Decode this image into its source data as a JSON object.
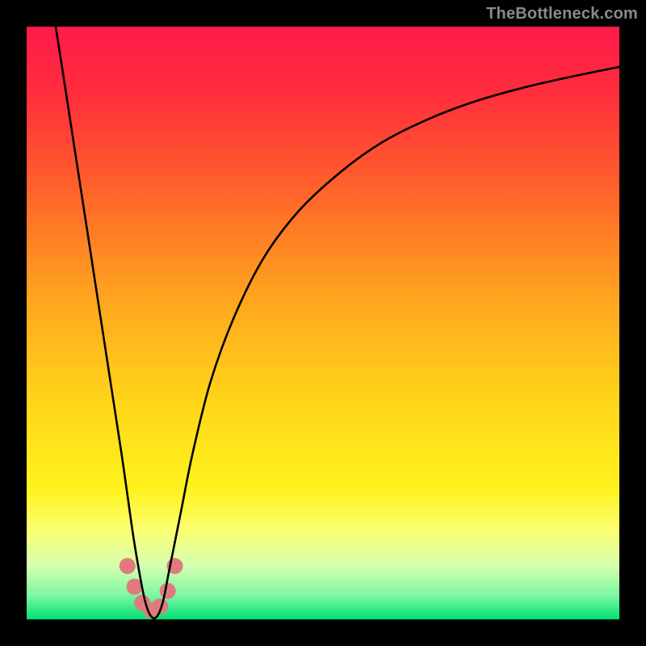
{
  "watermark": "TheBottleneck.com",
  "chart_data": {
    "type": "line",
    "title": "",
    "xlabel": "",
    "ylabel": "",
    "xlim": [
      0,
      100
    ],
    "ylim": [
      0,
      100
    ],
    "grid": false,
    "background_gradient": {
      "stops": [
        {
          "offset": 0.0,
          "color": "#ff1a4b"
        },
        {
          "offset": 0.12,
          "color": "#ff2f3b"
        },
        {
          "offset": 0.28,
          "color": "#ff642a"
        },
        {
          "offset": 0.45,
          "color": "#ffa21f"
        },
        {
          "offset": 0.62,
          "color": "#ffd21a"
        },
        {
          "offset": 0.78,
          "color": "#fff31c"
        },
        {
          "offset": 0.85,
          "color": "#fbff73"
        },
        {
          "offset": 0.91,
          "color": "#d4ffb0"
        },
        {
          "offset": 0.96,
          "color": "#7cf7a4"
        },
        {
          "offset": 1.0,
          "color": "#00e173"
        }
      ]
    },
    "series": [
      {
        "name": "curve",
        "stroke": "#000000",
        "stroke_width": 2.6,
        "x": [
          4.9,
          6,
          8,
          10,
          12,
          14,
          16,
          17,
          18,
          19,
          20,
          21,
          22,
          23,
          24,
          26,
          28,
          31,
          35,
          40,
          46,
          53,
          60,
          68,
          76,
          85,
          94,
          100
        ],
        "y": [
          100,
          93,
          80,
          67,
          54,
          41,
          28,
          21,
          14,
          8,
          3,
          0.5,
          0.5,
          3,
          8,
          18,
          28,
          40,
          51,
          61,
          69,
          75.5,
          80.5,
          84.5,
          87.5,
          90,
          92,
          93.2
        ]
      }
    ],
    "markers": {
      "name": "bottom-cluster",
      "fill": "#e07b7d",
      "radius": 10,
      "points": [
        {
          "x": 17.0,
          "y": 9.0
        },
        {
          "x": 18.2,
          "y": 5.5
        },
        {
          "x": 19.5,
          "y": 2.8
        },
        {
          "x": 21.0,
          "y": 1.5
        },
        {
          "x": 22.5,
          "y": 2.2
        },
        {
          "x": 23.8,
          "y": 4.8
        },
        {
          "x": 25.0,
          "y": 9.0
        }
      ]
    }
  }
}
